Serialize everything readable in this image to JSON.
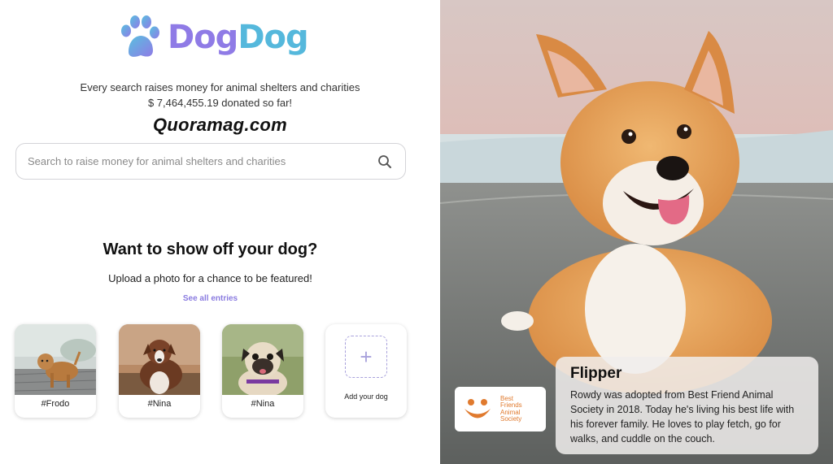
{
  "brand": {
    "name_part1": "Dog",
    "name_part2": "Dog",
    "colors": {
      "primary": "#8f7be6",
      "secondary": "#55b8dc"
    }
  },
  "header": {
    "tagline": "Every search raises money for animal shelters and charities",
    "donated": "$ 7,464,455.19 donated so far!",
    "watermark": "Quoramag.com"
  },
  "search": {
    "placeholder": "Search to raise money for animal shelters and charities",
    "value": "",
    "icon": "search-icon"
  },
  "showcase": {
    "title": "Want to show off your dog?",
    "subtitle": "Upload a photo for a chance to be featured!",
    "see_all": "See all entries",
    "entries": [
      {
        "label": "#Frodo"
      },
      {
        "label": "#Nina"
      },
      {
        "label": "#Nina"
      }
    ],
    "add_label": "Add your dog"
  },
  "featured": {
    "name": "Flipper",
    "story": "Rowdy was adopted from Best Friend Animal Society in 2018. Today he's living his best life with his forever family. He loves to play fetch, go for walks, and cuddle on the couch.",
    "shelter": {
      "line1": "Best",
      "line2": "Friends",
      "line3": "Animal",
      "line4": "Society",
      "color": "#e07a2e"
    }
  }
}
